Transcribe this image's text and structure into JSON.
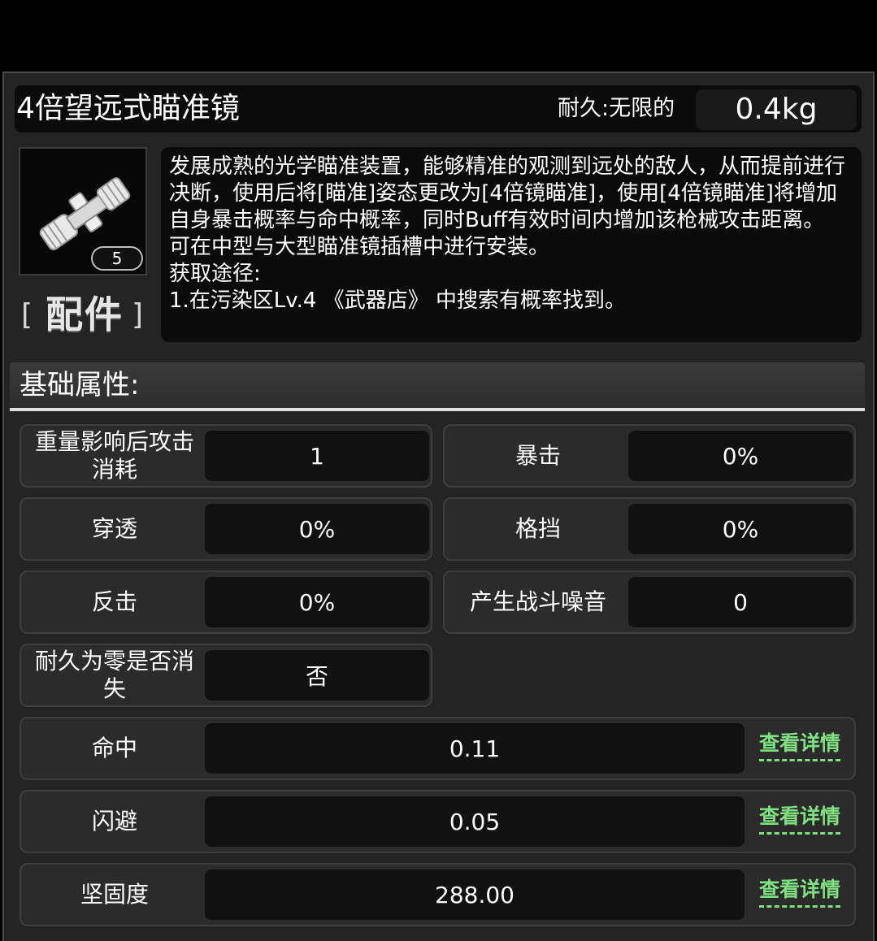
{
  "item": {
    "name": "4倍望远式瞄准镜",
    "durability_label": "耐久:无限的",
    "weight": "0.4kg",
    "level": "5",
    "category": "配件",
    "category_open": "[",
    "category_close": "]",
    "icon": "scope-icon",
    "description": "发展成熟的光学瞄准装置，能够精准的观测到远处的敌人，从而提前进行决断，使用后将[瞄准]姿态更改为[4倍镜瞄准]，使用[4倍镜瞄准]将增加自身暴击概率与命中概率，同时Buff有效时间内增加该枪械攻击距离。\n可在中型与大型瞄准镜插槽中进行安装。\n获取途径:\n1.在污染区Lv.4 《武器店》 中搜索有概率找到。"
  },
  "section": {
    "title": "基础属性:"
  },
  "stats": {
    "weight_cost": {
      "label": "重量影响后攻击消耗",
      "value": "1"
    },
    "crit": {
      "label": "暴击",
      "value": "0%"
    },
    "penetration": {
      "label": "穿透",
      "value": "0%"
    },
    "block": {
      "label": "格挡",
      "value": "0%"
    },
    "counter": {
      "label": "反击",
      "value": "0%"
    },
    "noise": {
      "label": "产生战斗噪音",
      "value": "0"
    },
    "vanish": {
      "label": "耐久为零是否消失",
      "value": "否"
    },
    "hit": {
      "label": "命中",
      "value": "0.11",
      "detail": "查看详情"
    },
    "dodge": {
      "label": "闪避",
      "value": "0.05",
      "detail": "查看详情"
    },
    "sturdiness": {
      "label": "坚固度",
      "value": "288.00",
      "detail": "查看详情"
    }
  },
  "colors": {
    "detail_link": "#7fe07f",
    "panel": "#242424",
    "value_bg": "#111111"
  }
}
